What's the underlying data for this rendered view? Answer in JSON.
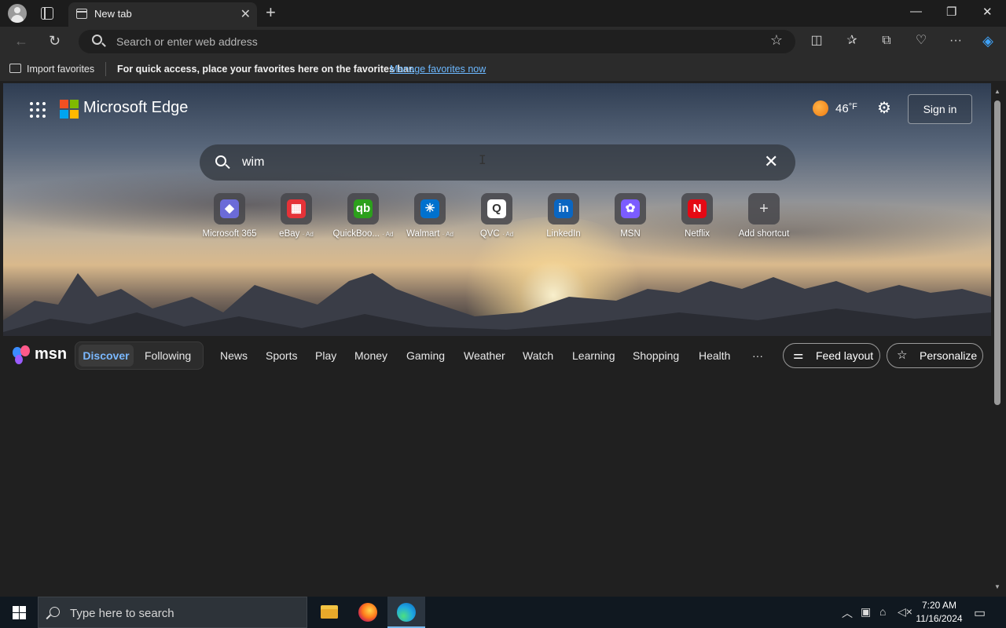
{
  "browser": {
    "tab_title": "New tab",
    "address_placeholder": "Search or enter web address",
    "controls": {
      "minimize": "—",
      "restore": "❐",
      "close": "✕"
    }
  },
  "favorites_bar": {
    "import_label": "Import favorites",
    "message": "For quick access, place your favorites here on the favorites bar.",
    "manage_link": "Manage favorites now"
  },
  "newtab": {
    "brand": "Microsoft Edge",
    "temperature": "46",
    "temp_unit": "°F",
    "sign_in": "Sign in",
    "search_value": "wim",
    "shortcuts": [
      {
        "label": "Microsoft 365",
        "ad": "",
        "glyph": "◆",
        "color": "#6b6bd8"
      },
      {
        "label": "eBay",
        "ad": "· Ad",
        "glyph": "▦",
        "color": "#e53238"
      },
      {
        "label": "QuickBoo...",
        "ad": "· Ad",
        "glyph": "qb",
        "color": "#2ca01c"
      },
      {
        "label": "Walmart",
        "ad": "· Ad",
        "glyph": "✳",
        "color": "#0071ce"
      },
      {
        "label": "QVC",
        "ad": "· Ad",
        "glyph": "Q",
        "color": "#ffffff"
      },
      {
        "label": "LinkedIn",
        "ad": "",
        "glyph": "in",
        "color": "#0a66c2"
      },
      {
        "label": "MSN",
        "ad": "",
        "glyph": "✿",
        "color": "#7b5cff"
      },
      {
        "label": "Netflix",
        "ad": "",
        "glyph": "N",
        "color": "#e50914"
      },
      {
        "label": "Add shortcut",
        "ad": "",
        "glyph": "+",
        "color": "#5a5a5a"
      }
    ]
  },
  "msn": {
    "logo_text": "msn",
    "tabs": {
      "discover": "Discover",
      "following": "Following"
    },
    "links": [
      "News",
      "Sports",
      "Play",
      "Money",
      "Gaming",
      "Weather",
      "Watch",
      "Learning",
      "Shopping",
      "Health"
    ],
    "more": "···",
    "feed_layout": "Feed layout",
    "personalize": "Personalize"
  },
  "taskbar": {
    "search_placeholder": "Type here to search",
    "time": "7:20 AM",
    "date": "11/16/2024"
  }
}
